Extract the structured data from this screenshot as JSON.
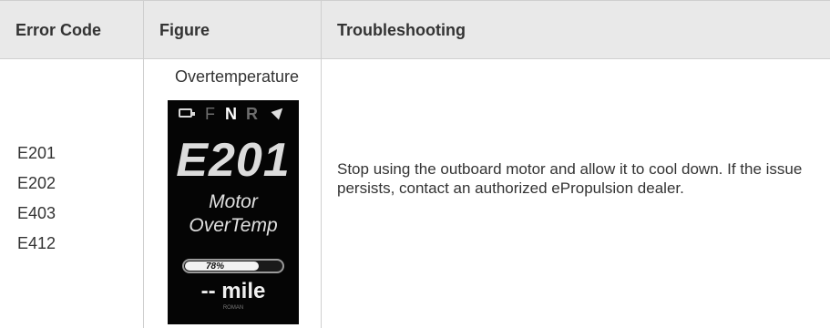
{
  "headers": {
    "col1": "Error Code",
    "col2": "Figure",
    "col3": "Troubleshooting"
  },
  "row": {
    "codes": [
      "E201",
      "E202",
      "E403",
      "E412"
    ],
    "figure_title": "Overtemperature",
    "display": {
      "gears": {
        "f": "F",
        "n": "N",
        "r": "R"
      },
      "code": "E201",
      "message_line1": "Motor",
      "message_line2": "OverTemp",
      "battery_percent_text": "78%",
      "battery_fraction": 0.78,
      "distance": "-- mile",
      "distance_sub": "ROMAN"
    },
    "troubleshooting": "Stop using the outboard motor and allow it to cool down. If the issue persists, contact an authorized ePropulsion dealer."
  }
}
